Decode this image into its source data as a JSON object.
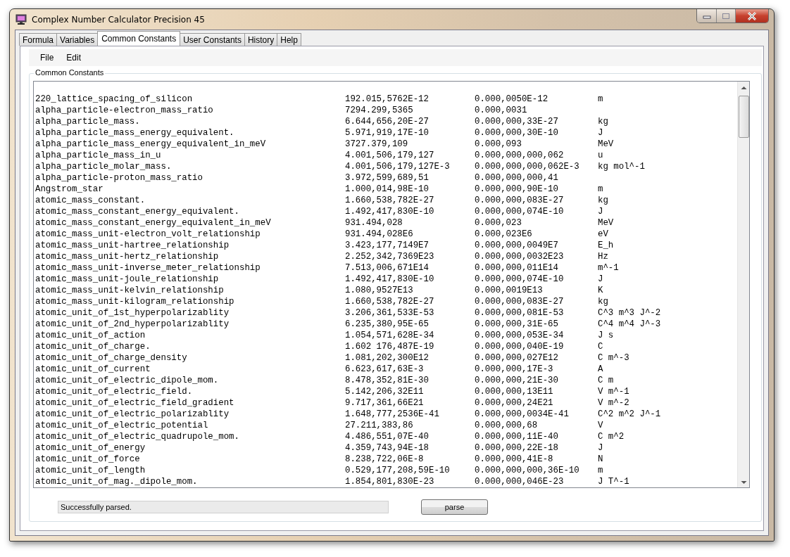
{
  "window": {
    "title": "Complex Number Calculator Precision 45"
  },
  "tabs": [
    {
      "label": "Formula",
      "selected": false
    },
    {
      "label": "Variables",
      "selected": false
    },
    {
      "label": "Common Constants",
      "selected": true
    },
    {
      "label": "User Constants",
      "selected": false
    },
    {
      "label": "History",
      "selected": false
    },
    {
      "label": "Help",
      "selected": false
    }
  ],
  "menu": [
    "File",
    "Edit"
  ],
  "group": {
    "title": "Common Constants"
  },
  "constants": [
    {
      "name": "220_lattice_spacing_of_silicon",
      "value": "192.015,5762E-12",
      "uncertainty": "0.000,0050E-12",
      "unit": "m"
    },
    {
      "name": "alpha_particle-electron_mass_ratio",
      "value": "7294.299,5365",
      "uncertainty": "0.000,0031"
    },
    {
      "name": "alpha_particle_mass.",
      "value": "6.644,656,20E-27",
      "uncertainty": "0.000,000,33E-27",
      "unit": "kg"
    },
    {
      "name": "alpha_particle_mass_energy_equivalent.",
      "value": "5.971,919,17E-10",
      "uncertainty": "0.000,000,30E-10",
      "unit": "J"
    },
    {
      "name": "alpha_particle_mass_energy_equivalent_in_meV",
      "value": "3727.379,109",
      "uncertainty": "0.000,093",
      "unit": "MeV"
    },
    {
      "name": "alpha_particle_mass_in_u",
      "value": "4.001,506,179,127",
      "uncertainty": "0.000,000,000,062",
      "unit": "u"
    },
    {
      "name": "alpha_particle_molar_mass.",
      "value": "4.001,506,179,127E-3",
      "uncertainty": "0.000,000,000,062E-3",
      "unit": "kg mol^-1"
    },
    {
      "name": "alpha_particle-proton_mass_ratio",
      "value": "3.972,599,689,51",
      "uncertainty": "0.000,000,000,41"
    },
    {
      "name": "Angstrom_star",
      "value": "1.000,014,98E-10",
      "uncertainty": "0.000,000,90E-10",
      "unit": "m"
    },
    {
      "name": "atomic_mass_constant.",
      "value": "1.660,538,782E-27",
      "uncertainty": "0.000,000,083E-27",
      "unit": "kg"
    },
    {
      "name": "atomic_mass_constant_energy_equivalent.",
      "value": "1.492,417,830E-10",
      "uncertainty": "0.000,000,074E-10",
      "unit": "J"
    },
    {
      "name": "atomic_mass_constant_energy_equivalent_in_meV",
      "value": "931.494,028",
      "uncertainty": "0.000,023",
      "unit": "MeV"
    },
    {
      "name": "atomic_mass_unit-electron_volt_relationship",
      "value": "931.494,028E6",
      "uncertainty": "0.000,023E6",
      "unit": "eV"
    },
    {
      "name": "atomic_mass_unit-hartree_relationship",
      "value": "3.423,177,7149E7",
      "uncertainty": "0.000,000,0049E7",
      "unit": "E_h"
    },
    {
      "name": "atomic_mass_unit-hertz_relationship",
      "value": "2.252,342,7369E23",
      "uncertainty": "0.000,000,0032E23",
      "unit": "Hz"
    },
    {
      "name": "atomic_mass_unit-inverse_meter_relationship",
      "value": "7.513,006,671E14",
      "uncertainty": "0.000,000,011E14",
      "unit": "m^-1"
    },
    {
      "name": "atomic_mass_unit-joule_relationship",
      "value": "1.492,417,830E-10",
      "uncertainty": "0.000,000,074E-10",
      "unit": "J"
    },
    {
      "name": "atomic_mass_unit-kelvin_relationship",
      "value": "1.080,9527E13",
      "uncertainty": "0.000,0019E13",
      "unit": "K"
    },
    {
      "name": "atomic_mass_unit-kilogram_relationship",
      "value": "1.660,538,782E-27",
      "uncertainty": "0.000,000,083E-27",
      "unit": "kg"
    },
    {
      "name": "atomic_unit_of_1st_hyperpolarizablity",
      "value": "3.206,361,533E-53",
      "uncertainty": "0.000,000,081E-53",
      "unit": "C^3 m^3 J^-2"
    },
    {
      "name": "atomic_unit_of_2nd_hyperpolarizablity",
      "value": "6.235,380,95E-65",
      "uncertainty": "0.000,000,31E-65",
      "unit": "C^4 m^4 J^-3"
    },
    {
      "name": "atomic_unit_of_action",
      "value": "1.054,571,628E-34",
      "uncertainty": "0.000,000,053E-34",
      "unit": "J s"
    },
    {
      "name": "atomic_unit_of_charge.",
      "value": "1.602 176,487E-19",
      "uncertainty": "0.000,000,040E-19",
      "unit": "C"
    },
    {
      "name": "atomic_unit_of_charge_density",
      "value": "1.081,202,300E12",
      "uncertainty": "0.000,000,027E12",
      "unit": "C m^-3"
    },
    {
      "name": "atomic_unit_of_current",
      "value": "6.623,617,63E-3",
      "uncertainty": "0.000,000,17E-3",
      "unit": "A"
    },
    {
      "name": "atomic_unit_of_electric_dipole_mom.",
      "value": "8.478,352,81E-30",
      "uncertainty": "0.000,000,21E-30",
      "unit": "C m"
    },
    {
      "name": "atomic_unit_of_electric_field.",
      "value": "5.142,206,32E11",
      "uncertainty": "0.000,000,13E11",
      "unit": "V m^-1"
    },
    {
      "name": "atomic_unit_of_electric_field_gradient",
      "value": "9.717,361,66E21",
      "uncertainty": "0.000,000,24E21",
      "unit": "V m^-2"
    },
    {
      "name": "atomic_unit_of_electric_polarizablity",
      "value": "1.648,777,2536E-41",
      "uncertainty": "0.000,000,0034E-41",
      "unit": "C^2 m^2 J^-1"
    },
    {
      "name": "atomic_unit_of_electric_potential",
      "value": "27.211,383,86",
      "uncertainty": "0.000,000,68",
      "unit": "V"
    },
    {
      "name": "atomic_unit_of_electric_quadrupole_mom.",
      "value": "4.486,551,07E-40",
      "uncertainty": "0.000,000,11E-40",
      "unit": "C m^2"
    },
    {
      "name": "atomic_unit_of_energy",
      "value": "4.359,743,94E-18",
      "uncertainty": "0.000,000,22E-18",
      "unit": "J"
    },
    {
      "name": "atomic_unit_of_force",
      "value": "8.238,722,06E-8",
      "uncertainty": "0.000,000,41E-8",
      "unit": "N"
    },
    {
      "name": "atomic_unit_of_length",
      "value": "0.529,177,208,59E-10",
      "uncertainty": "0.000,000,000,36E-10",
      "unit": "m"
    },
    {
      "name": "atomic_unit_of_mag._dipole_mom.",
      "value": "1.854,801,830E-23",
      "uncertainty": "0.000,000,046E-23",
      "unit": "J T^-1"
    }
  ],
  "status": {
    "value": "Successfully parsed."
  },
  "parse_button": {
    "label": "parse"
  }
}
